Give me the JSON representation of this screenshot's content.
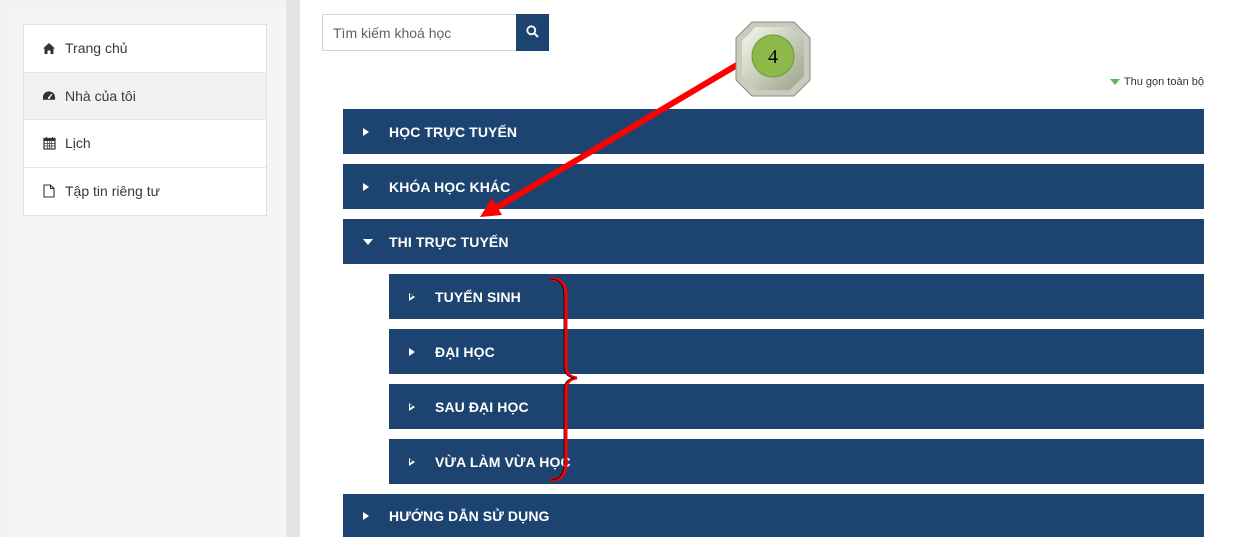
{
  "sidebar": {
    "items": [
      {
        "label": "Trang chủ",
        "icon": "home-icon"
      },
      {
        "label": "Nhà của tôi",
        "icon": "dashboard-icon"
      },
      {
        "label": "Lịch",
        "icon": "calendar-icon"
      },
      {
        "label": "Tập tin riêng tư",
        "icon": "file-icon"
      }
    ]
  },
  "search": {
    "placeholder": "Tìm kiếm khoá học",
    "icon": "search-icon"
  },
  "collapse_all": "Thu gọn toàn bộ",
  "categories": [
    {
      "label": "HỌC TRỰC TUYẾN",
      "state": "collapsed"
    },
    {
      "label": "KHÓA HỌC KHÁC",
      "state": "collapsed"
    },
    {
      "label": "THI TRỰC TUYẾN",
      "state": "expanded",
      "children": [
        {
          "label": "TUYỂN SINH",
          "state": "empty"
        },
        {
          "label": "ĐẠI HỌC",
          "state": "collapsed"
        },
        {
          "label": "SAU ĐẠI HỌC",
          "state": "empty"
        },
        {
          "label": "VỪA LÀM VỪA HỌC",
          "state": "empty"
        }
      ]
    },
    {
      "label": "HƯỚNG DẪN SỬ DỤNG",
      "state": "collapsed"
    }
  ],
  "annotation": {
    "badge_number": "4"
  },
  "colors": {
    "category_bg": "#1d4470",
    "arrow": "#ff0000",
    "badge_fill": "#8db84a",
    "collapse_icon": "#5cb85c"
  }
}
